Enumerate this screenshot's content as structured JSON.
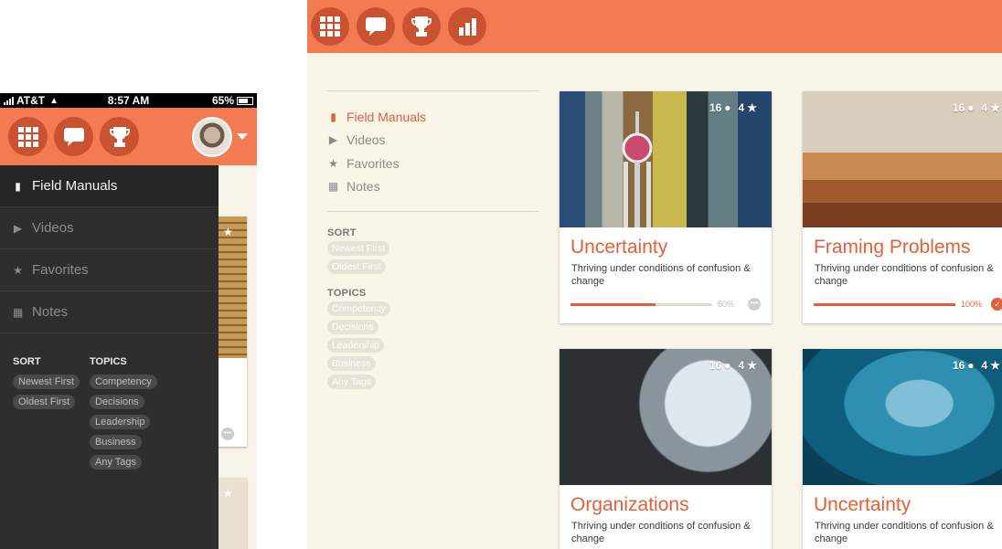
{
  "phone": {
    "status": {
      "carrier": "AT&T",
      "time": "8:57 AM",
      "battery": "65%"
    },
    "header_icons": [
      "grid-icon",
      "chat-icon",
      "trophy-icon"
    ],
    "drawer": {
      "nav": [
        {
          "label": "Field Manuals",
          "icon": "document-icon",
          "active": true
        },
        {
          "label": "Videos",
          "icon": "video-icon",
          "active": false
        },
        {
          "label": "Favorites",
          "icon": "star-icon",
          "active": false
        },
        {
          "label": "Notes",
          "icon": "calendar-icon",
          "active": false
        }
      ],
      "sort_heading": "SORT",
      "sort": [
        "Newest First",
        "Oldest First"
      ],
      "topics_heading": "TOPICS",
      "topics": [
        "Competency",
        "Decisions",
        "Leadership",
        "Business",
        "Any Tags"
      ]
    }
  },
  "desktop": {
    "header_icons": [
      "grid-icon",
      "chat-icon",
      "trophy-icon",
      "bar-chart-icon"
    ],
    "sidebar": {
      "nav": [
        {
          "label": "Field Manuals",
          "icon": "document-icon",
          "active": true
        },
        {
          "label": "Videos",
          "icon": "video-icon",
          "active": false
        },
        {
          "label": "Favorites",
          "icon": "star-icon",
          "active": false
        },
        {
          "label": "Notes",
          "icon": "calendar-icon",
          "active": false
        }
      ],
      "sort_heading": "SORT",
      "sort": [
        "Newest First",
        "Oldest First"
      ],
      "topics_heading": "TOPICS",
      "topics": [
        "Competency",
        "Decisions",
        "Leadership",
        "Business",
        "Any Tags"
      ]
    },
    "cards": [
      {
        "title": "Uncertainty",
        "description": "Thriving under conditions of confusion & change",
        "comments": "16",
        "stars": "4",
        "progress": 0.6,
        "progress_label": "60%",
        "status": "in-progress",
        "image": "city-skyline"
      },
      {
        "title": "Framing Problems",
        "description": "Thriving under conditions of confusion & change",
        "comments": "16",
        "stars": "4",
        "progress": 1.0,
        "progress_label": "100%",
        "status": "complete",
        "image": "desert-dunes"
      },
      {
        "title": "Organizations",
        "description": "Thriving under conditions of confusion & change",
        "comments": "16",
        "stars": "4",
        "image": "observatory-telescope"
      },
      {
        "title": "Uncertainty",
        "description": "Thriving under conditions of confusion & change",
        "comments": "16",
        "stars": "4",
        "image": "fish-school-ocean"
      }
    ]
  },
  "colors": {
    "accent": "#f27b52",
    "accent_dark": "#c95231",
    "title": "#e35f37",
    "background": "#f9f5e8",
    "drawer": "#2e2e2e"
  }
}
